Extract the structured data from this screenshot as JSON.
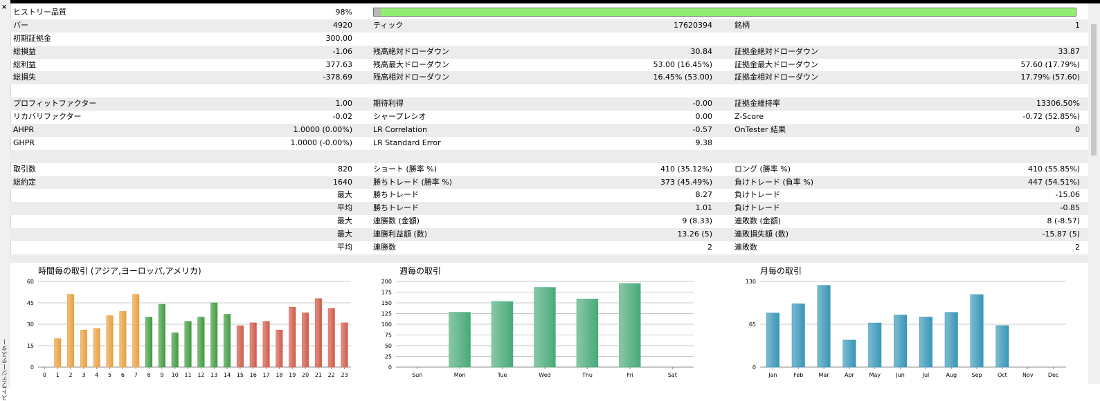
{
  "panel": {
    "close_label": "×",
    "vertical_label": "ストラテジーテスター"
  },
  "colors": {
    "quality_fill": "#90ee70",
    "quality_gray": "#b8b8b8"
  },
  "quality": {
    "label": "ヒストリー品質",
    "value": "98%",
    "fraction": 0.01
  },
  "rows": [
    {
      "gray": true,
      "cells": [
        "バー",
        "4920",
        "ティック",
        "17620394",
        "銘柄",
        "1"
      ]
    },
    {
      "gray": false,
      "cells": [
        "初期証拠金",
        "300.00",
        "",
        "",
        "",
        ""
      ]
    },
    {
      "gray": true,
      "cells": [
        "総損益",
        "-1.06",
        "残高絶対ドローダウン",
        "30.84",
        "証拠金絶対ドローダウン",
        "33.87"
      ]
    },
    {
      "gray": false,
      "cells": [
        "総利益",
        "377.63",
        "残高最大ドローダウン",
        "53.00 (16.45%)",
        "証拠金最大ドローダウン",
        "57.60 (17.79%)"
      ]
    },
    {
      "gray": true,
      "cells": [
        "総損失",
        "-378.69",
        "残高相対ドローダウン",
        "16.45% (53.00)",
        "証拠金相対ドローダウン",
        "17.79% (57.60)"
      ]
    },
    {
      "gray": false,
      "cells": [
        "",
        "",
        "",
        "",
        "",
        ""
      ]
    },
    {
      "gray": true,
      "cells": [
        "プロフィットファクター",
        "1.00",
        "期待利得",
        "-0.00",
        "証拠金維持率",
        "13306.50%"
      ]
    },
    {
      "gray": false,
      "cells": [
        "リカバリファクター",
        "-0.02",
        "シャープレシオ",
        "0.00",
        "Z-Score",
        "-0.72 (52.85%)"
      ]
    },
    {
      "gray": true,
      "cells": [
        "AHPR",
        "1.0000 (0.00%)",
        "LR Correlation",
        "-0.57",
        "OnTester 結果",
        "0"
      ]
    },
    {
      "gray": false,
      "cells": [
        "GHPR",
        "1.0000 (-0.00%)",
        "LR Standard Error",
        "9.38",
        "",
        ""
      ]
    },
    {
      "gray": true,
      "cells": [
        "",
        "",
        "",
        "",
        "",
        ""
      ]
    },
    {
      "gray": false,
      "cells": [
        "取引数",
        "820",
        "ショート (勝率 %)",
        "410 (35.12%)",
        "ロング (勝率 %)",
        "410 (55.85%)"
      ]
    },
    {
      "gray": true,
      "cells": [
        "総約定",
        "1640",
        "勝ちトレード (勝率 %)",
        "373 (45.49%)",
        "負けトレード (負率 %)",
        "447 (54.51%)"
      ]
    },
    {
      "gray": false,
      "cells": [
        "",
        "最大",
        "勝ちトレード",
        "8.27",
        "負けトレード",
        "-15.06"
      ]
    },
    {
      "gray": true,
      "cells": [
        "",
        "平均",
        "勝ちトレード",
        "1.01",
        "負けトレード",
        "-0.85"
      ]
    },
    {
      "gray": false,
      "cells": [
        "",
        "最大",
        "連勝数 (金額)",
        "9 (8.33)",
        "連敗数 (金額)",
        "8 (-8.57)"
      ]
    },
    {
      "gray": true,
      "cells": [
        "",
        "最大",
        "連勝利益額 (数)",
        "13.26 (5)",
        "連敗損失額 (数)",
        "-15.87 (5)"
      ]
    },
    {
      "gray": false,
      "cells": [
        "",
        "平均",
        "連勝数",
        "2",
        "連敗数",
        "2"
      ]
    },
    {
      "gray": true,
      "cells": [
        "",
        "",
        "",
        "",
        "",
        ""
      ]
    }
  ],
  "chart_data": [
    {
      "type": "bar",
      "title": "時間毎の取引 (アジア,ヨーロッパ,アメリカ)",
      "categories": [
        "0",
        "1",
        "2",
        "3",
        "4",
        "5",
        "6",
        "7",
        "8",
        "9",
        "10",
        "11",
        "12",
        "13",
        "14",
        "15",
        "16",
        "17",
        "18",
        "19",
        "20",
        "21",
        "22",
        "23"
      ],
      "values": [
        0,
        20,
        51,
        26,
        27,
        36,
        39,
        51,
        35,
        44,
        24,
        32,
        35,
        45,
        37,
        29,
        31,
        32,
        26,
        42,
        38,
        48,
        41,
        31
      ],
      "bar_colors": [
        "#e8a040",
        "#e8a040",
        "#e8a040",
        "#e8a040",
        "#e8a040",
        "#e8a040",
        "#e8a040",
        "#e8a040",
        "#3f9a3f",
        "#3f9a3f",
        "#3f9a3f",
        "#3f9a3f",
        "#3f9a3f",
        "#3f9a3f",
        "#3f9a3f",
        "#d05a48",
        "#d05a48",
        "#d05a48",
        "#d05a48",
        "#d05a48",
        "#d05a48",
        "#d05a48",
        "#d05a48",
        "#d05a48"
      ],
      "yticks": [
        0,
        15,
        30,
        45,
        60
      ],
      "ylim": [
        0,
        60
      ],
      "grid": true
    },
    {
      "type": "bar",
      "title": "週毎の取引",
      "categories": [
        "Sun",
        "Mon",
        "Tue",
        "Wed",
        "Thu",
        "Fri",
        "Sat"
      ],
      "values": [
        0,
        128,
        153,
        186,
        159,
        195,
        0
      ],
      "bar_color": "#48aa78",
      "yticks": [
        0,
        25,
        50,
        75,
        100,
        125,
        150,
        175,
        200
      ],
      "ylim": [
        0,
        200
      ],
      "grid": true
    },
    {
      "type": "bar",
      "title": "月毎の取引",
      "categories": [
        "Jan",
        "Feb",
        "Mar",
        "Apr",
        "May",
        "Jun",
        "Jul",
        "Aug",
        "Sep",
        "Oct",
        "Nov",
        "Dec"
      ],
      "values": [
        82,
        96,
        124,
        41,
        67,
        79,
        76,
        83,
        110,
        63,
        0,
        0
      ],
      "bar_color": "#3896b8",
      "yticks": [
        0,
        65,
        130
      ],
      "ylim": [
        0,
        130
      ],
      "grid": true
    }
  ]
}
